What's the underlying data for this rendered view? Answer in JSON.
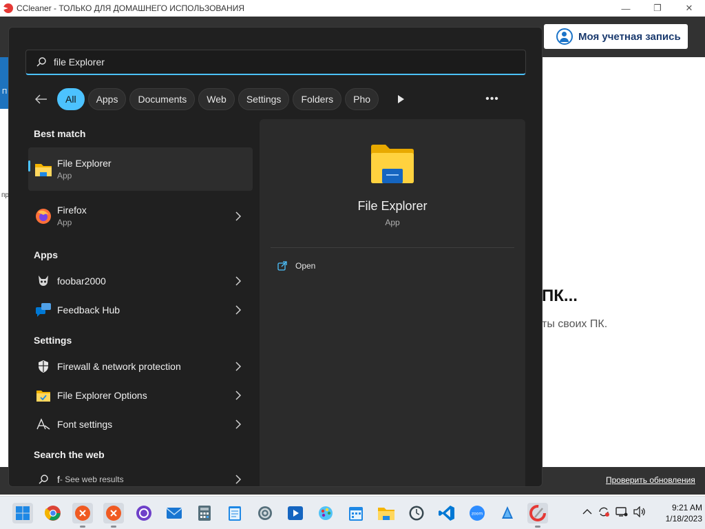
{
  "window": {
    "title": "CCleaner - ТОЛЬКО ДЛЯ ДОМАШНЕГО ИСПОЛЬЗОВАНИЯ",
    "account_button": "Моя учетная запись",
    "side_fragments": [
      "П",
      "пр"
    ],
    "heading_fragment": "ПК...",
    "sub_fragment": "ты своих ПК.",
    "footer_link": "Проверить обновления"
  },
  "search": {
    "query": "file Explorer",
    "filters": [
      "All",
      "Apps",
      "Documents",
      "Web",
      "Settings",
      "Folders",
      "Pho"
    ],
    "active_filter": "All"
  },
  "results": {
    "best_match_header": "Best match",
    "best_match": {
      "name": "File Explorer",
      "type": "App"
    },
    "second": {
      "name": "Firefox",
      "type": "App"
    },
    "apps_header": "Apps",
    "apps": [
      {
        "name": "foobar2000"
      },
      {
        "name": "Feedback Hub"
      }
    ],
    "settings_header": "Settings",
    "settings": [
      {
        "name": "Firewall & network protection"
      },
      {
        "name": "File Explorer Options"
      },
      {
        "name": "Font settings"
      }
    ],
    "web_header": "Search the web",
    "web_query": "f",
    "web_suffix": " - See web results"
  },
  "detail": {
    "name": "File Explorer",
    "type": "App",
    "action": "Open"
  },
  "taskbar": {
    "icons": [
      "windows-start",
      "chrome",
      "ccleaner",
      "ccleaner-2",
      "github-desktop",
      "mail",
      "calculator",
      "notepad",
      "settings",
      "media-player",
      "paint",
      "calendar",
      "file-explorer",
      "clock",
      "vscode",
      "zoom",
      "vlc",
      "ccleaner-active"
    ],
    "time": "9:21 AM",
    "date": "1/18/2023"
  },
  "colors": {
    "accent": "#4cc2ff",
    "panel": "#202020",
    "detail": "#2b2b2b"
  }
}
